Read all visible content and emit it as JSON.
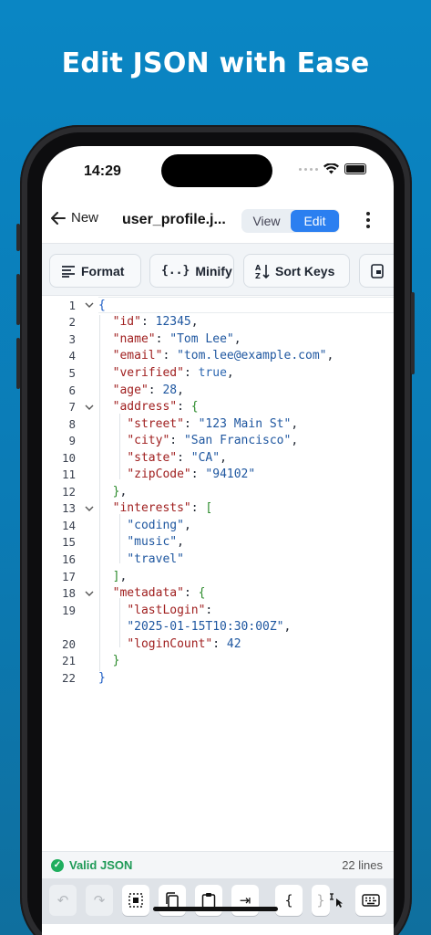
{
  "headline": "Edit JSON with Ease",
  "status_bar": {
    "time": "14:29"
  },
  "nav": {
    "back_label": "New",
    "filename": "user_profile.j...",
    "modes": [
      "View",
      "Edit"
    ],
    "active_mode": "Edit"
  },
  "toolbar": {
    "format_label": "Format",
    "minify_label": "Minify",
    "sort_label": "Sort Keys"
  },
  "editor": {
    "lines": [
      {
        "n": "1",
        "fold": true,
        "tokens": [
          [
            "br",
            "{"
          ]
        ]
      },
      {
        "n": "2",
        "tokens": [
          [
            "p",
            "  "
          ],
          [
            "k",
            "\"id\""
          ],
          [
            "p",
            ": "
          ],
          [
            "n",
            "12345"
          ],
          [
            "p",
            ","
          ]
        ]
      },
      {
        "n": "3",
        "tokens": [
          [
            "p",
            "  "
          ],
          [
            "k",
            "\"name\""
          ],
          [
            "p",
            ": "
          ],
          [
            "s",
            "\"Tom Lee\""
          ],
          [
            "p",
            ","
          ]
        ]
      },
      {
        "n": "4",
        "tokens": [
          [
            "p",
            "  "
          ],
          [
            "k",
            "\"email\""
          ],
          [
            "p",
            ": "
          ],
          [
            "s",
            "\"tom.lee@example.com\""
          ],
          [
            "p",
            ","
          ]
        ]
      },
      {
        "n": "5",
        "tokens": [
          [
            "p",
            "  "
          ],
          [
            "k",
            "\"verified\""
          ],
          [
            "p",
            ": "
          ],
          [
            "b",
            "true"
          ],
          [
            "p",
            ","
          ]
        ]
      },
      {
        "n": "6",
        "tokens": [
          [
            "p",
            "  "
          ],
          [
            "k",
            "\"age\""
          ],
          [
            "p",
            ": "
          ],
          [
            "n",
            "28"
          ],
          [
            "p",
            ","
          ]
        ]
      },
      {
        "n": "7",
        "fold": true,
        "tokens": [
          [
            "p",
            "  "
          ],
          [
            "k",
            "\"address\""
          ],
          [
            "p",
            ": "
          ],
          [
            "brg",
            "{"
          ]
        ]
      },
      {
        "n": "8",
        "tokens": [
          [
            "p",
            "    "
          ],
          [
            "k",
            "\"street\""
          ],
          [
            "p",
            ": "
          ],
          [
            "s",
            "\"123 Main St\""
          ],
          [
            "p",
            ","
          ]
        ]
      },
      {
        "n": "9",
        "tokens": [
          [
            "p",
            "    "
          ],
          [
            "k",
            "\"city\""
          ],
          [
            "p",
            ": "
          ],
          [
            "s",
            "\"San Francisco\""
          ],
          [
            "p",
            ","
          ]
        ]
      },
      {
        "n": "10",
        "tokens": [
          [
            "p",
            "    "
          ],
          [
            "k",
            "\"state\""
          ],
          [
            "p",
            ": "
          ],
          [
            "s",
            "\"CA\""
          ],
          [
            "p",
            ","
          ]
        ]
      },
      {
        "n": "11",
        "tokens": [
          [
            "p",
            "    "
          ],
          [
            "k",
            "\"zipCode\""
          ],
          [
            "p",
            ": "
          ],
          [
            "s",
            "\"94102\""
          ]
        ]
      },
      {
        "n": "12",
        "tokens": [
          [
            "p",
            "  "
          ],
          [
            "brg",
            "}"
          ],
          [
            "p",
            ","
          ]
        ]
      },
      {
        "n": "13",
        "fold": true,
        "tokens": [
          [
            "p",
            "  "
          ],
          [
            "k",
            "\"interests\""
          ],
          [
            "p",
            ": "
          ],
          [
            "brg",
            "["
          ]
        ]
      },
      {
        "n": "14",
        "tokens": [
          [
            "p",
            "    "
          ],
          [
            "s",
            "\"coding\""
          ],
          [
            "p",
            ","
          ]
        ]
      },
      {
        "n": "15",
        "tokens": [
          [
            "p",
            "    "
          ],
          [
            "s",
            "\"music\""
          ],
          [
            "p",
            ","
          ]
        ]
      },
      {
        "n": "16",
        "tokens": [
          [
            "p",
            "    "
          ],
          [
            "s",
            "\"travel\""
          ]
        ]
      },
      {
        "n": "17",
        "tokens": [
          [
            "p",
            "  "
          ],
          [
            "brg",
            "]"
          ],
          [
            "p",
            ","
          ]
        ]
      },
      {
        "n": "18",
        "fold": true,
        "tokens": [
          [
            "p",
            "  "
          ],
          [
            "k",
            "\"metadata\""
          ],
          [
            "p",
            ": "
          ],
          [
            "brg",
            "{"
          ]
        ]
      },
      {
        "n": "19",
        "tokens": [
          [
            "p",
            "    "
          ],
          [
            "k",
            "\"lastLogin\""
          ],
          [
            "p",
            ":"
          ]
        ]
      },
      {
        "n": "",
        "tokens": [
          [
            "p",
            "    "
          ],
          [
            "s",
            "\"2025-01-15T10:30:00Z\""
          ],
          [
            "p",
            ","
          ]
        ]
      },
      {
        "n": "20",
        "tokens": [
          [
            "p",
            "    "
          ],
          [
            "k",
            "\"loginCount\""
          ],
          [
            "p",
            ": "
          ],
          [
            "n",
            "42"
          ]
        ]
      },
      {
        "n": "21",
        "tokens": [
          [
            "p",
            "  "
          ],
          [
            "brg",
            "}"
          ]
        ]
      },
      {
        "n": "22",
        "tokens": [
          [
            "br",
            "}"
          ]
        ]
      }
    ]
  },
  "footer": {
    "valid_label": "Valid JSON",
    "line_count": "22 lines"
  },
  "keyboard_bar": {
    "buttons": [
      "undo-icon",
      "redo-icon",
      "select-all-icon",
      "copy-icon",
      "paste-icon",
      "tab-icon",
      "open-brace",
      "close-brace",
      "cursor-icon",
      "keyboard-icon"
    ],
    "open_brace": "{"
  },
  "colors": {
    "accent": "#2b7ff0",
    "valid": "#1fae5e",
    "background": "#0a86c4"
  }
}
